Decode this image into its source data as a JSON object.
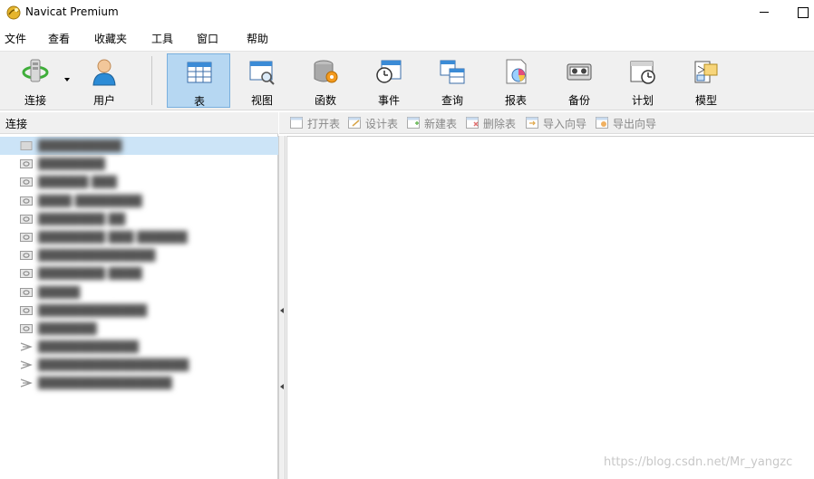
{
  "window": {
    "title": "Navicat Premium"
  },
  "menu": [
    "文件",
    "查看",
    "收藏夹",
    "工具",
    "窗口",
    "帮助"
  ],
  "toolbar": {
    "connection": "连接",
    "user": "用户",
    "objects": [
      "表",
      "视图",
      "函数",
      "事件",
      "查询",
      "报表",
      "备份",
      "计划",
      "模型"
    ],
    "active": "表"
  },
  "left_panel": {
    "header": "连接",
    "connections": [
      {
        "name": "██████████",
        "type": "selected"
      },
      {
        "name": "████████",
        "type": "db"
      },
      {
        "name": "██████ ███",
        "type": "db"
      },
      {
        "name": "████ ████████",
        "type": "db"
      },
      {
        "name": "████████ ██",
        "type": "db"
      },
      {
        "name": "████████ ███ ██████",
        "type": "db"
      },
      {
        "name": "██████████████",
        "type": "db"
      },
      {
        "name": "████████ ████",
        "type": "db"
      },
      {
        "name": "█████",
        "type": "db"
      },
      {
        "name": "█████████████",
        "type": "db"
      },
      {
        "name": "███████",
        "type": "db"
      },
      {
        "name": "████████████",
        "type": "link"
      },
      {
        "name": "██████████████████",
        "type": "link"
      },
      {
        "name": "████████████████",
        "type": "link"
      }
    ]
  },
  "object_toolbar": [
    "打开表",
    "设计表",
    "新建表",
    "删除表",
    "导入向导",
    "导出向导"
  ],
  "watermark": "https://blog.csdn.net/Mr_yangzc",
  "colors": {
    "selection": "#cce4f7",
    "active_tool": "#b6d7f2",
    "toolbar_bg": "#f0f0f0"
  }
}
